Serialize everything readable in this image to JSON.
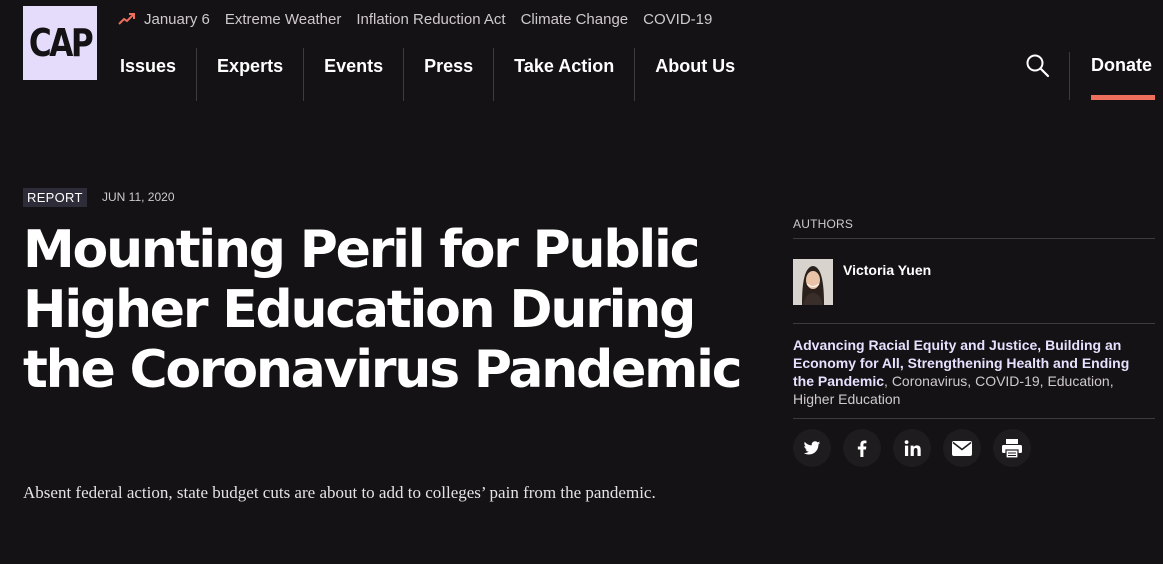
{
  "brand": {
    "logo_text": "CAP"
  },
  "trending": {
    "icon": "trending-up-icon",
    "links": [
      "January 6",
      "Extreme Weather",
      "Inflation Reduction Act",
      "Climate Change",
      "COVID-19"
    ]
  },
  "nav": {
    "items": [
      "Issues",
      "Experts",
      "Events",
      "Press",
      "Take Action",
      "About Us"
    ],
    "search_icon": "search-icon",
    "donate_label": "Donate"
  },
  "article": {
    "tag": "REPORT",
    "date": "JUN 11, 2020",
    "title": "Mounting Peril for Public Higher Education During the Coronavirus Pandemic",
    "dek": "Absent federal action, state budget cuts are about to add to colleges’ pain from the pandemic."
  },
  "sidebar": {
    "authors_label": "AUTHORS",
    "authors": [
      {
        "name": "Victoria Yuen"
      }
    ],
    "topics_primary": [
      "Advancing Racial Equity and Justice",
      "Building an Economy for All",
      "Strengthening Health and Ending the Pandemic"
    ],
    "topics_secondary": [
      "Coronavirus",
      "COVID-19",
      "Education",
      "Higher Education"
    ],
    "share_icons": [
      "twitter-icon",
      "facebook-icon",
      "linkedin-icon",
      "email-icon",
      "print-icon"
    ]
  },
  "colors": {
    "background": "#141214",
    "logo_bg": "#e4dcfa",
    "accent": "#ee6f5b",
    "topic_link": "#e8e0ff"
  }
}
